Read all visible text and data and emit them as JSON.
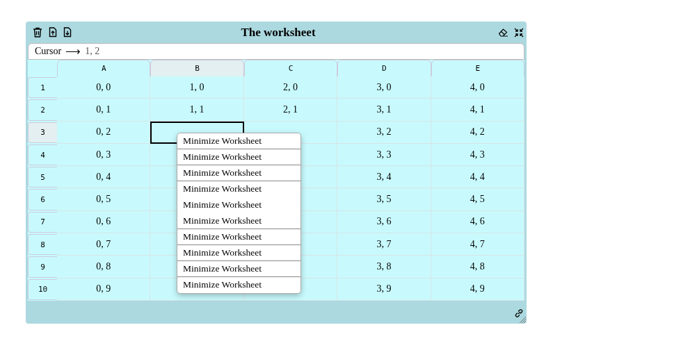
{
  "window": {
    "title": "The worksheet"
  },
  "cursor_bar": {
    "label": "Cursor",
    "arrow": "⟶",
    "value": "1, 2"
  },
  "columns": [
    {
      "label": "A",
      "selected": false
    },
    {
      "label": "B",
      "selected": true
    },
    {
      "label": "C",
      "selected": false
    },
    {
      "label": "D",
      "selected": false
    },
    {
      "label": "E",
      "selected": false
    }
  ],
  "rows": [
    {
      "label": "1",
      "selected": false,
      "cells": [
        "0, 0",
        "1, 0",
        "2, 0",
        "3, 0",
        "4, 0"
      ]
    },
    {
      "label": "2",
      "selected": false,
      "cells": [
        "0, 1",
        "1, 1",
        "2, 1",
        "3, 1",
        "4, 1"
      ]
    },
    {
      "label": "3",
      "selected": true,
      "cells": [
        "0, 2",
        null,
        null,
        "3, 2",
        "4, 2"
      ]
    },
    {
      "label": "4",
      "selected": false,
      "cells": [
        "0, 3",
        null,
        null,
        "3, 3",
        "4, 3"
      ]
    },
    {
      "label": "5",
      "selected": false,
      "cells": [
        "0, 4",
        null,
        null,
        "3, 4",
        "4, 4"
      ]
    },
    {
      "label": "6",
      "selected": false,
      "cells": [
        "0, 5",
        null,
        null,
        "3, 5",
        "4, 5"
      ]
    },
    {
      "label": "7",
      "selected": false,
      "cells": [
        "0, 6",
        null,
        null,
        "3, 6",
        "4, 6"
      ]
    },
    {
      "label": "8",
      "selected": false,
      "cells": [
        "0, 7",
        null,
        null,
        "3, 7",
        "4, 7"
      ]
    },
    {
      "label": "9",
      "selected": false,
      "cells": [
        "0, 8",
        null,
        null,
        "3, 8",
        "4, 8"
      ]
    },
    {
      "label": "10",
      "selected": false,
      "cells": [
        "0, 9",
        null,
        null,
        "3, 9",
        "4, 9"
      ]
    }
  ],
  "context_menu": {
    "items": [
      {
        "label": "Minimize Worksheet",
        "separator_below": true
      },
      {
        "label": "Minimize Worksheet",
        "separator_below": true
      },
      {
        "label": "Minimize Worksheet",
        "separator_below": true
      },
      {
        "label": "Minimize Worksheet",
        "separator_below": false
      },
      {
        "label": "Minimize Worksheet",
        "separator_below": false
      },
      {
        "label": "Minimize Worksheet",
        "separator_below": true
      },
      {
        "label": "Minimize Worksheet",
        "separator_below": true
      },
      {
        "label": "Minimize Worksheet",
        "separator_below": true
      },
      {
        "label": "Minimize Worksheet",
        "separator_below": true
      },
      {
        "label": "Minimize Worksheet",
        "separator_below": false
      }
    ]
  }
}
